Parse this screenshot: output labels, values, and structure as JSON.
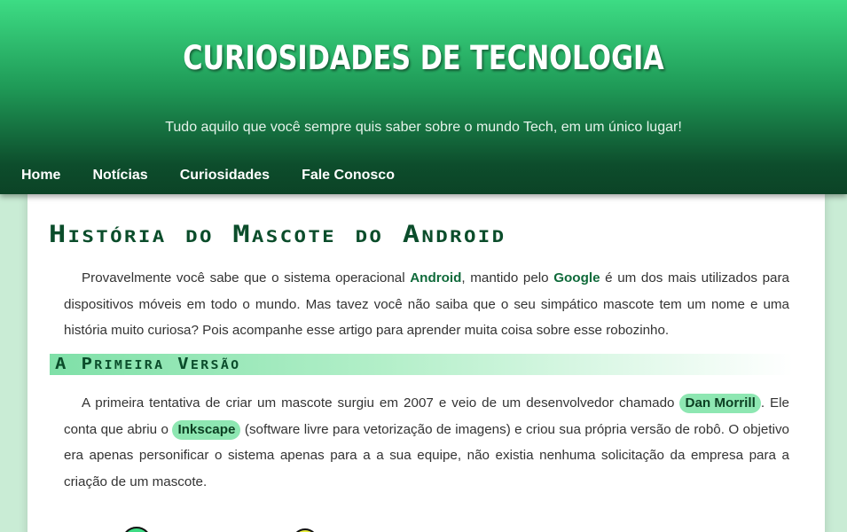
{
  "header": {
    "title": "CURIOSIDADES DE TECNOLOGIA",
    "subtitle": "Tudo aquilo que você sempre quis saber sobre o mundo Tech, em um único lugar!"
  },
  "nav": {
    "items": [
      {
        "label": "Home"
      },
      {
        "label": "Notícias"
      },
      {
        "label": "Curiosidades"
      },
      {
        "label": "Fale Conosco"
      }
    ]
  },
  "article": {
    "title": "História do Mascote do Android",
    "intro": {
      "t1": "Provavelmente você sabe que o sistema operacional ",
      "android": "Android",
      "t2": ", mantido pelo ",
      "google": "Google",
      "t3": " é um dos mais utilizados para dispositivos móveis em todo o mundo. Mas tavez você não saiba que o seu simpático mascote tem um nome e uma história muito curiosa? Pois acompanhe esse artigo para aprender muita coisa sobre esse robozinho."
    },
    "section1": {
      "heading": "A Primeira Versão",
      "t1": "A primeira tentativa de criar um mascote surgiu em 2007 e veio de um desenvolvedor chamado ",
      "person": "Dan Morrill",
      "t2": ". Ele conta que abriu o ",
      "software": "Inkscape",
      "t3": " (software livre para vetorização de imagens) e criou sua própria versão de robô. O objetivo era apenas personificar o sistema apenas para a a sua equipe, não existia nenhuma solicitação da empresa para a criação de um mascote."
    }
  },
  "colors": {
    "brand": "#3ddc84",
    "dark_green": "#0b4d2b",
    "highlight_pill": "#8ee7b2"
  }
}
